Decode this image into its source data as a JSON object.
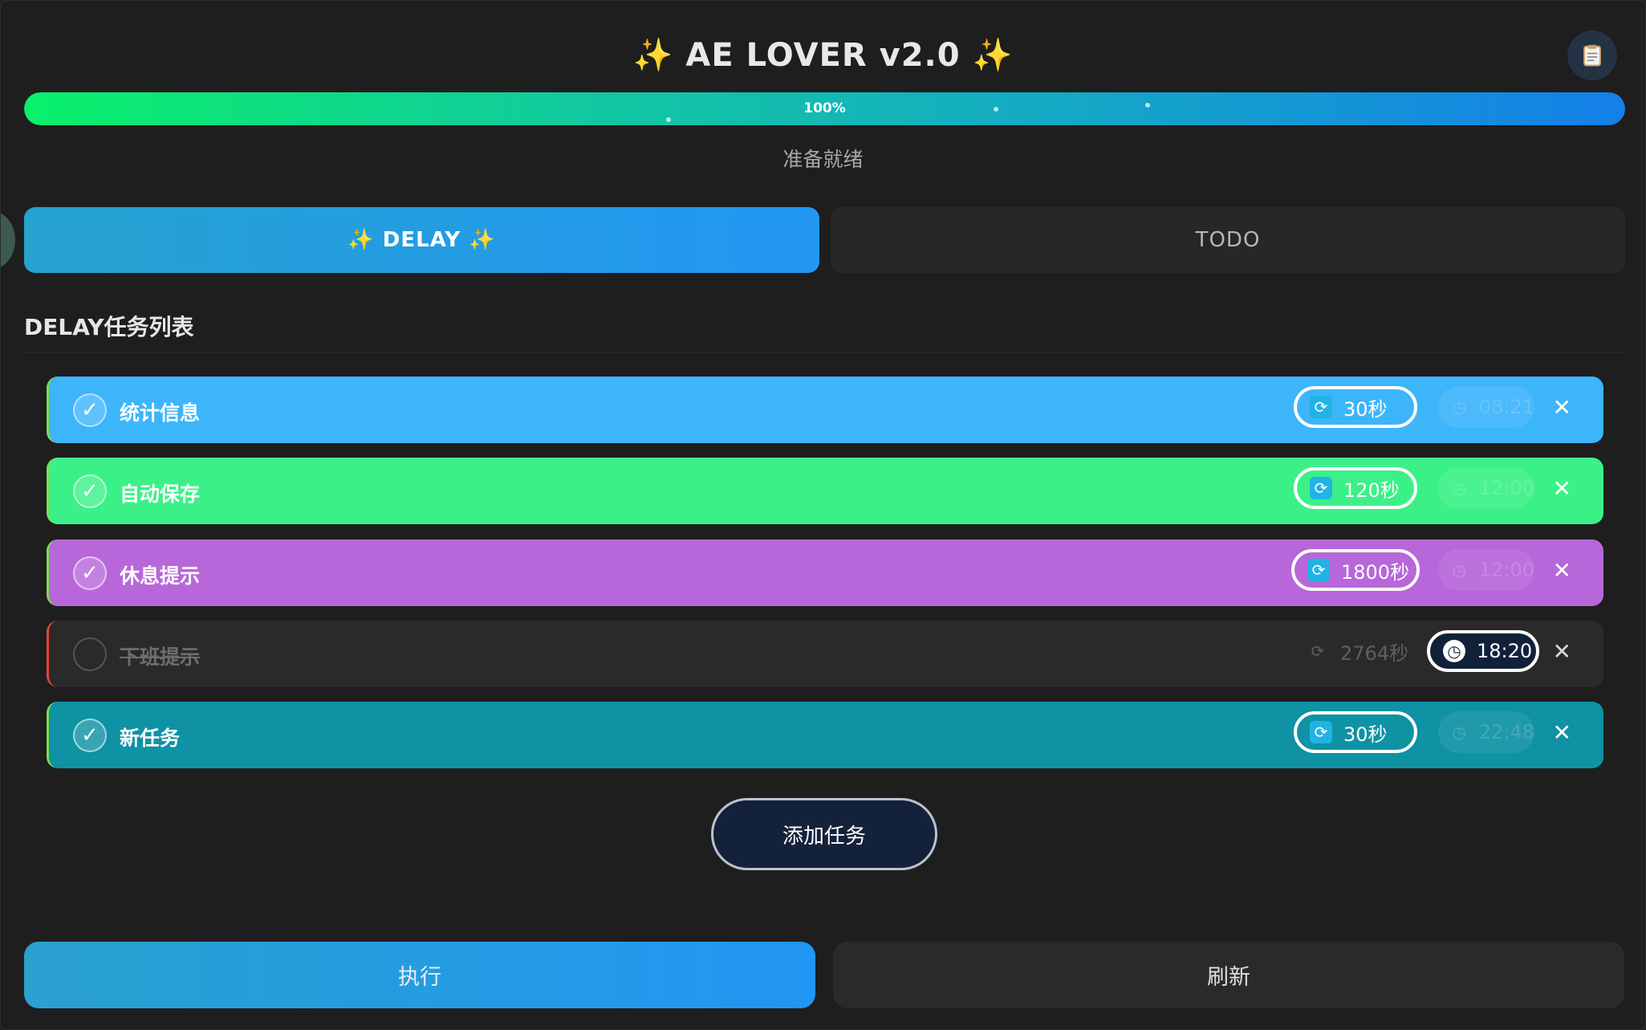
{
  "app": {
    "title": "✨ AE LOVER v2.0 ✨",
    "log_icon": "clipboard-icon",
    "progress_percent": 100,
    "progress_text": "100%",
    "status": "准备就绪"
  },
  "tabs": {
    "delay_label": "✨ DELAY ✨",
    "todo_label": "TODO",
    "active": "DELAY"
  },
  "section": {
    "title": "DELAY任务列表"
  },
  "tasks": [
    {
      "name": "统计信息",
      "enabled": true,
      "interval": "30秒",
      "time": "08:21",
      "mode": "interval",
      "color": "#3db5fb"
    },
    {
      "name": "自动保存",
      "enabled": true,
      "interval": "120秒",
      "time": "12:00",
      "mode": "interval",
      "color": "#3bf187"
    },
    {
      "name": "休息提示",
      "enabled": true,
      "interval": "1800秒",
      "time": "12:00",
      "mode": "interval",
      "color": "#b767d9"
    },
    {
      "name": "下班提示",
      "enabled": false,
      "interval": "2764秒",
      "time": "18:20",
      "mode": "time",
      "color": "#2a2a2a"
    },
    {
      "name": "新任务",
      "enabled": true,
      "interval": "30秒",
      "time": "22:48",
      "mode": "interval",
      "color": "#0e92a4"
    }
  ],
  "icons": {
    "check": "✓",
    "close": "✕",
    "refresh": "refresh-icon",
    "clock": "clock-icon"
  },
  "buttons": {
    "add": "添加任务",
    "run": "执行",
    "refresh": "刷新"
  }
}
